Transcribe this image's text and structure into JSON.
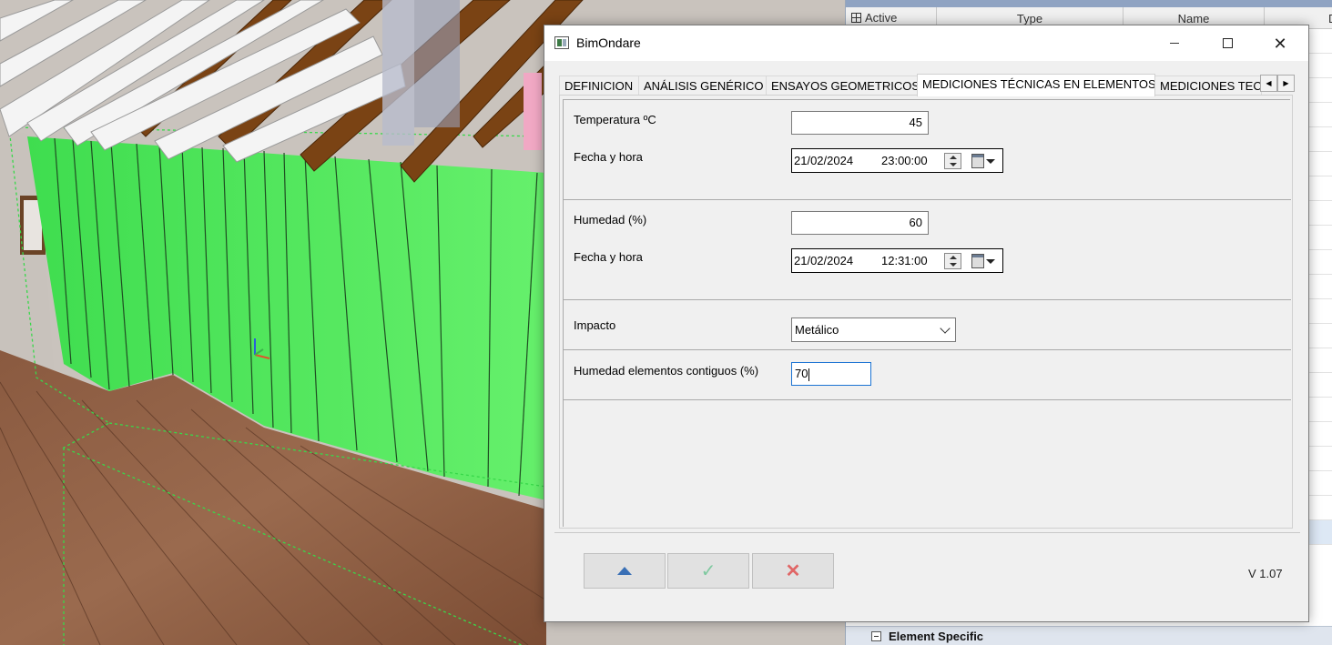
{
  "background_app": {
    "ifc_columns": [
      "Active",
      "Type",
      "Name",
      "Descr"
    ],
    "element_specific_label": "Element Specific"
  },
  "dialog": {
    "title": "BimOndare",
    "tabs": [
      {
        "label": "DEFINICION",
        "active": false
      },
      {
        "label": "ANÁLISIS GENÉRICO",
        "active": false
      },
      {
        "label": "ENSAYOS GEOMETRICOS",
        "active": false
      },
      {
        "label": "MEDICIONES TÉCNICAS EN ELEMENTOS",
        "active": true
      },
      {
        "label": "MEDICIONES TECNICAS",
        "active": false
      }
    ],
    "temperature": {
      "label": "Temperatura ºC",
      "value": "45",
      "datetime_label": "Fecha y hora",
      "date": "21/02/2024",
      "time": "23:00:00"
    },
    "humidity": {
      "label": "Humedad (%)",
      "value": "60",
      "datetime_label": "Fecha y hora",
      "date": "21/02/2024",
      "time": "12:31:00"
    },
    "impact": {
      "label": "Impacto",
      "selected": "Metálico"
    },
    "contiguous_humidity": {
      "label": "Humedad elementos contiguos (%)",
      "value": "70"
    },
    "version": "V 1.07",
    "colors": {
      "up_arrow": "#3a70b6",
      "ok_check": "#7fc9a0",
      "cancel_x": "#e06666",
      "focus_border": "#1b73d3"
    }
  }
}
